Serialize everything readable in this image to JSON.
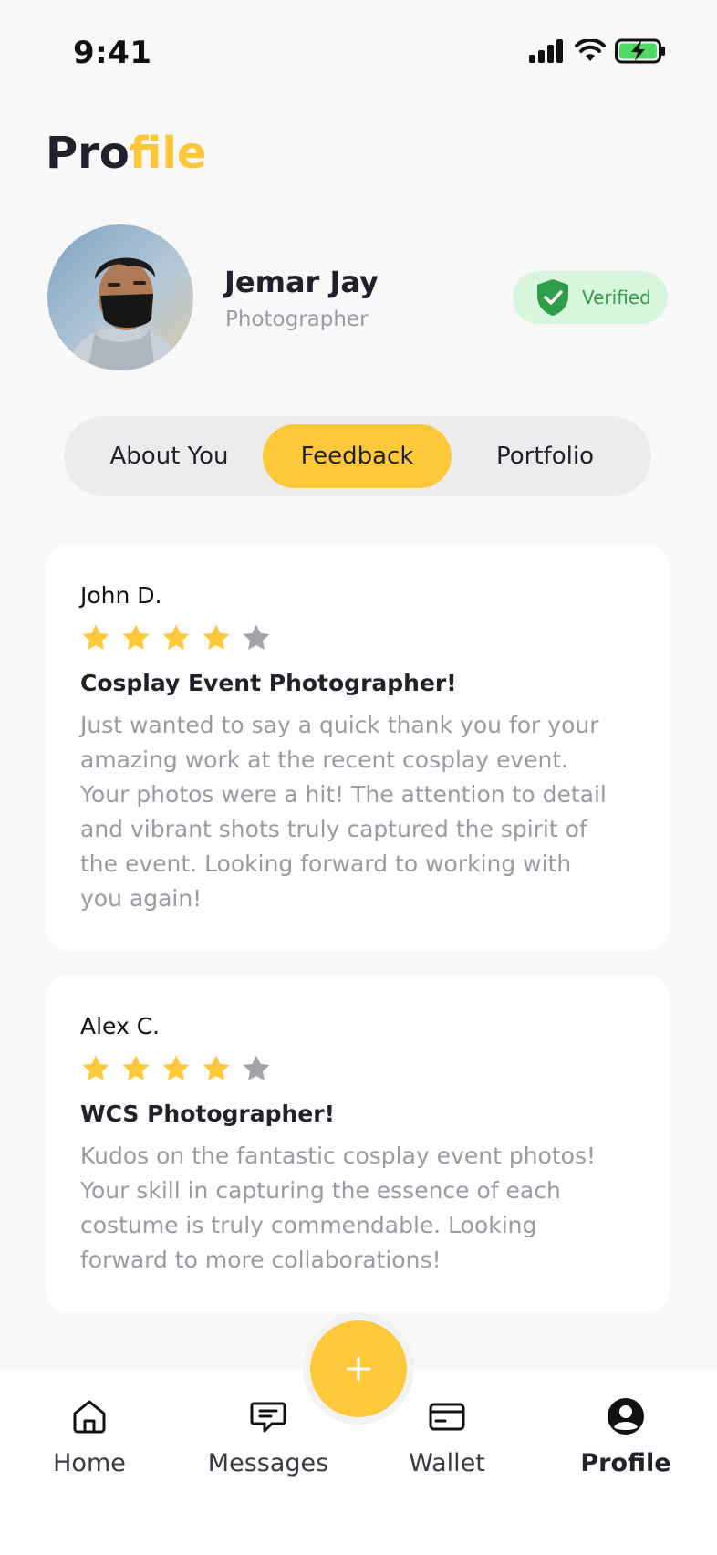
{
  "status_bar": {
    "time": "9:41"
  },
  "header": {
    "title_part1": "Pro",
    "title_part2": "file"
  },
  "profile": {
    "name": "Jemar Jay",
    "role": "Photographer",
    "verified_label": "Verified"
  },
  "tabs": [
    {
      "label": "About You",
      "active": false
    },
    {
      "label": "Feedback",
      "active": true
    },
    {
      "label": "Portfolio",
      "active": false
    }
  ],
  "reviews": [
    {
      "author": "John D.",
      "rating": 4,
      "max_rating": 5,
      "title": "Cosplay Event Photographer!",
      "lines": [
        "Just wanted to say a quick thank you for your",
        "amazing work at the recent cosplay event.",
        "Your photos were a hit! The attention to detail",
        "and vibrant shots truly captured the spirit of",
        "the event. Looking forward to working with",
        "you again!"
      ]
    },
    {
      "author": "Alex C.",
      "rating": 4,
      "max_rating": 5,
      "title": "WCS Photographer!",
      "lines": [
        "Kudos on the fantastic cosplay event photos!",
        "Your skill in capturing the essence of each",
        "costume is truly commendable. Looking",
        "forward to more collaborations!"
      ]
    }
  ],
  "fab": {
    "icon": "plus-icon"
  },
  "bottom_nav": [
    {
      "label": "Home",
      "icon": "home-icon",
      "active": false
    },
    {
      "label": "Messages",
      "icon": "message-icon",
      "active": false
    },
    {
      "label": "Wallet",
      "icon": "wallet-icon",
      "active": false
    },
    {
      "label": "Profile",
      "icon": "user-circle-icon",
      "active": true
    }
  ],
  "colors": {
    "accent": "#fdc93b",
    "text": "#22212b",
    "muted": "#9a9aa3",
    "star_empty": "#a3a3aa",
    "verified_bg": "#d8f5dd",
    "verified_green": "#2e9e48"
  }
}
